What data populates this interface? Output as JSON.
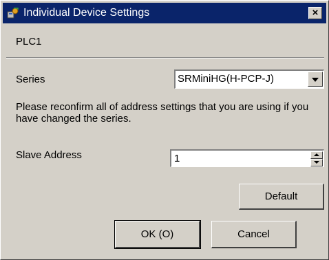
{
  "window": {
    "title": "Individual Device Settings",
    "close_glyph": "×",
    "icon": "device-settings-icon"
  },
  "device": {
    "name": "PLC1"
  },
  "series": {
    "label": "Series",
    "value": "SRMiniHG(H-PCP-J)"
  },
  "message": "Please reconfirm all of address settings that you are using if you have changed the series.",
  "slave_address": {
    "label": "Slave Address",
    "value": "1"
  },
  "buttons": {
    "default": "Default",
    "ok": "OK (O)",
    "cancel": "Cancel"
  }
}
